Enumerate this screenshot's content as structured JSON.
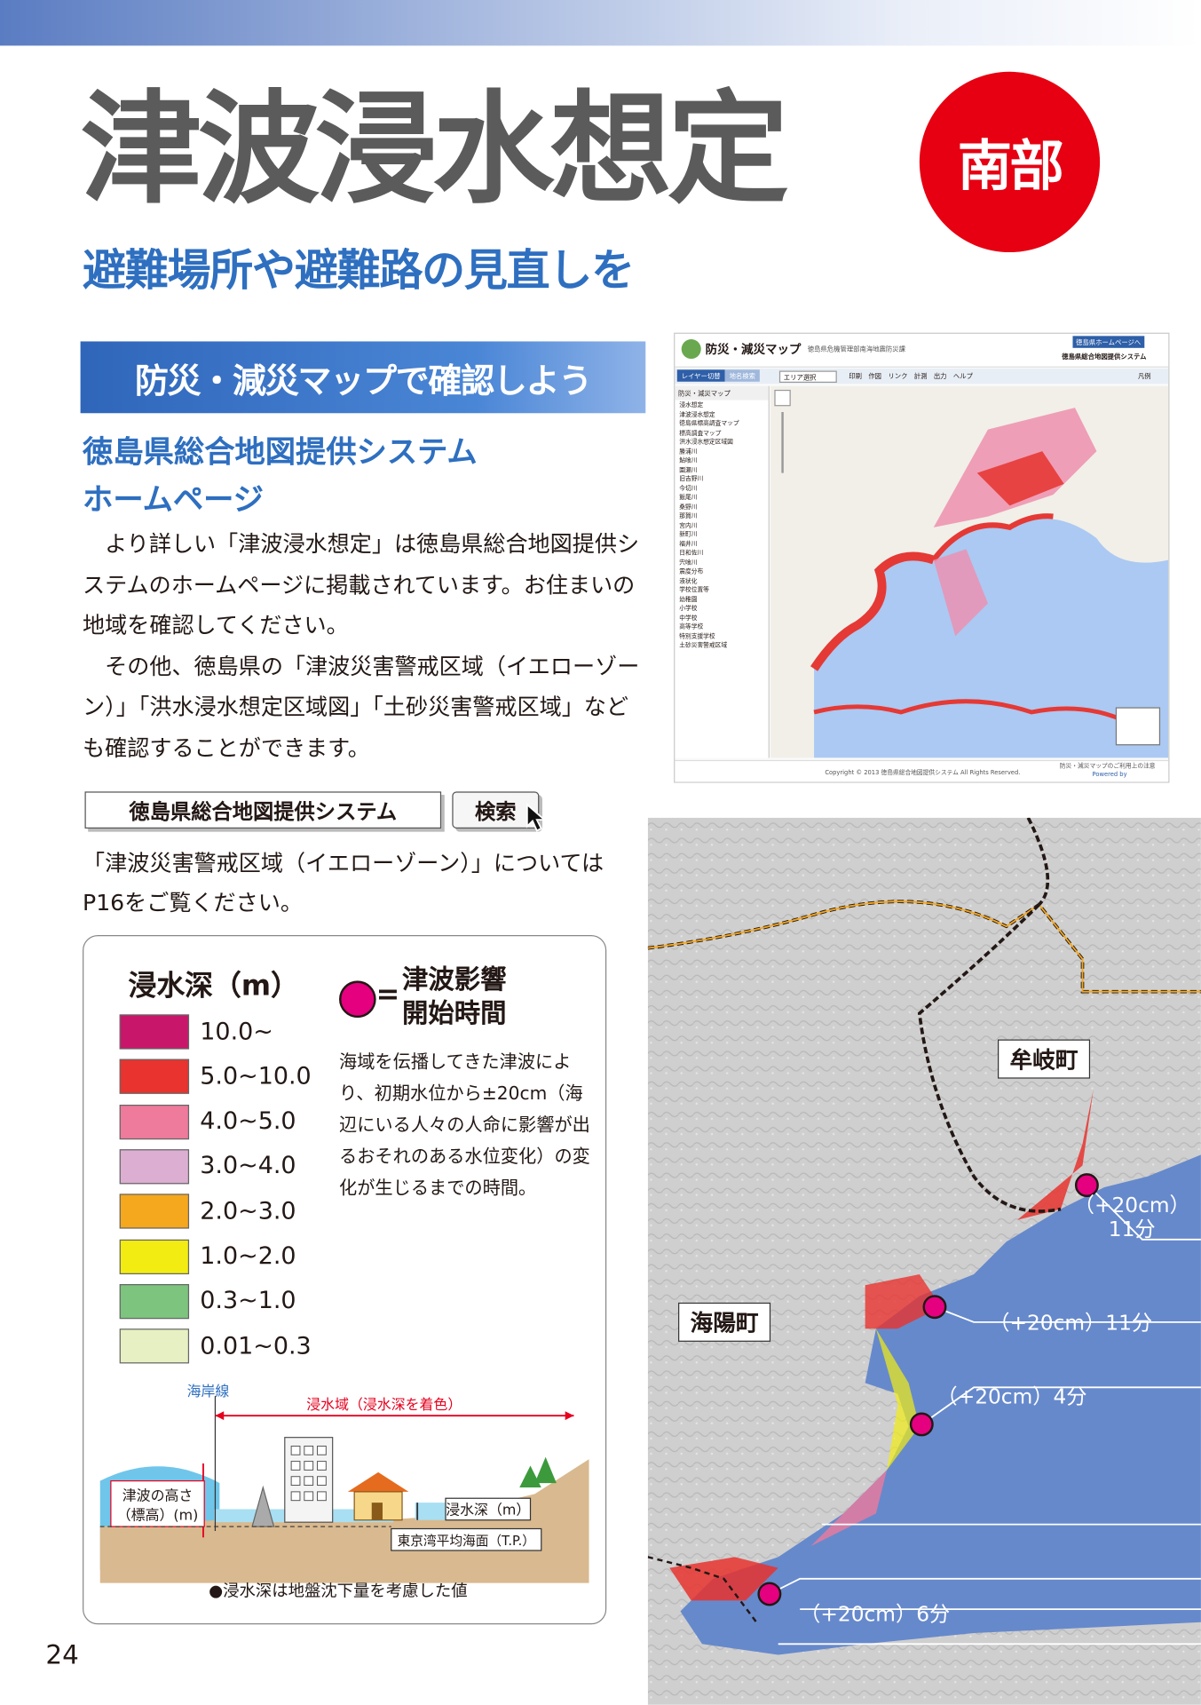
{
  "header": {
    "title": "津波浸水想定",
    "badge": "南部",
    "subtitle": "避難場所や避難路の見直しを"
  },
  "section": {
    "banner": "防災・減災マップで確認しよう",
    "hp_title_line1": "徳島県総合地図提供システム",
    "hp_title_line2": "ホームページ",
    "paragraph1": "より詳しい「津波浸水想定」は徳島県総合地図提供システムのホームページに掲載されています。お住まいの地域を確認してください。",
    "paragraph2": "その他、徳島県の「津波災害警戒区域（イエローゾーン）」「洪水浸水想定区域図」「土砂災害警戒区域」なども確認することができます。",
    "search_text": "徳島県総合地図提供システム",
    "search_button": "検索",
    "note": "「津波災害警戒区域（イエローゾーン）」についてはP16をご覧ください。"
  },
  "legend": {
    "title": "浸水深（m）",
    "items": [
      {
        "label": "10.0~",
        "color": "#c8176b"
      },
      {
        "label": "5.0~10.0",
        "color": "#e8332e"
      },
      {
        "label": "4.0~5.0",
        "color": "#ee7a9c"
      },
      {
        "label": "3.0~4.0",
        "color": "#dcaed2"
      },
      {
        "label": "2.0~3.0",
        "color": "#f5a71d"
      },
      {
        "label": "1.0~2.0",
        "color": "#f2ec12"
      },
      {
        "label": "0.3~1.0",
        "color": "#7dc47f"
      },
      {
        "label": "0.01~0.3",
        "color": "#e6f0c2"
      }
    ],
    "impact_title_line1": "津波影響",
    "impact_title_line2": "開始時間",
    "impact_symbol": "=",
    "impact_desc": "海域を伝播してきた津波により、初期水位から±20cm（海辺にいる人々の人命に影響が出るおそれのある水位変化）の変化が生じるまでの時間。"
  },
  "diagram": {
    "coastline": "海岸線",
    "inundation_area": "浸水域（浸水深を着色）",
    "tsunami_height_line1": "津波の高さ",
    "tsunami_height_line2": "（標高）(m)",
    "depth_label": "浸水深（m）",
    "datum_label": "東京湾平均海面（T.P.）",
    "footnote": "●浸水深は地盤沈下量を考慮した値"
  },
  "page_number": "24",
  "web_screenshot": {
    "app_title": "防災・減災マップ",
    "dept": "徳島県危機管理部南海地震防災課",
    "top_link": "徳島県ホームページへ",
    "system_name": "徳島県総合地図提供システム",
    "tabs": [
      "レイヤー切替",
      "地名検索"
    ],
    "toolbar": [
      "エリア選択",
      "印刷",
      "作図",
      "リンク",
      "計測",
      "出力",
      "ヘルプ"
    ],
    "legend_btn": "凡例",
    "layer_heading": "防災・減災マップ",
    "layers": [
      "浸水想定",
      "津波浸水想定",
      "徳島県標高調査マップ",
      "標高調査マップ",
      "洪水浸水想定区域図",
      "勝浦川",
      "鮎喰川",
      "園瀬川",
      "旧吉野川",
      "今切川",
      "飯尾川",
      "桑野川",
      "那賀川",
      "宮内川",
      "新町川",
      "福井川",
      "日和佐川",
      "宍喰川",
      "震度分布",
      "液状化",
      "学校位置等",
      "幼稚園",
      "小学校",
      "中学校",
      "高等学校",
      "特別支援学校",
      "土砂災害警戒区域"
    ],
    "copyright": "Copyright © 2013 徳島県総合地図提供システム All Rights Reserved.",
    "footer_right": "防災・減災マップのご利用上の注意",
    "powered": "Powered by"
  },
  "map": {
    "towns": [
      "牟岐町",
      "海陽町"
    ],
    "times": [
      "（+20cm）\n11分",
      "（+20cm）11分",
      "（+20cm）4分",
      "（+20cm）6分"
    ]
  }
}
